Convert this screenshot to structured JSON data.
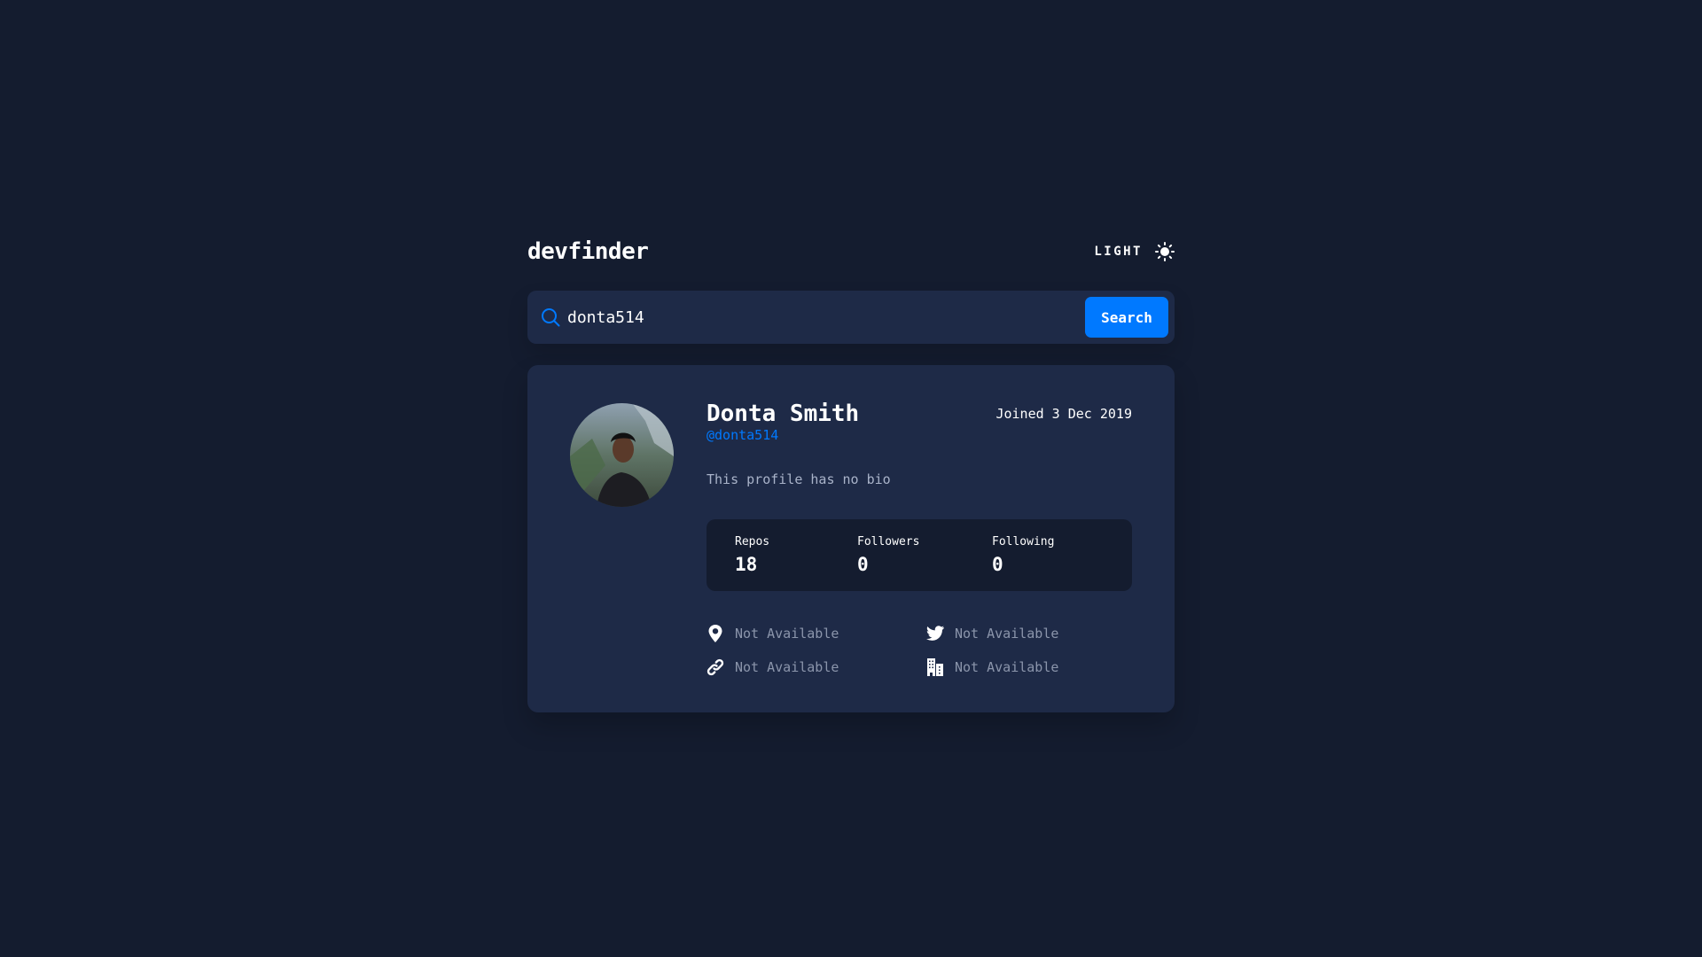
{
  "app": {
    "logo": "devfinder",
    "theme_label": "LIGHT"
  },
  "search": {
    "value": "donta514",
    "button_label": "Search"
  },
  "profile": {
    "name": "Donta Smith",
    "login": "@donta514",
    "joined": "Joined 3 Dec 2019",
    "bio": "This profile has no bio"
  },
  "stats": [
    {
      "label": "Repos",
      "value": "18"
    },
    {
      "label": "Followers",
      "value": "0"
    },
    {
      "label": "Following",
      "value": "0"
    }
  ],
  "links": {
    "location": "Not Available",
    "twitter": "Not Available",
    "blog": "Not Available",
    "company": "Not Available"
  },
  "icons": {
    "theme": "sun-icon",
    "search": "search-icon",
    "location": "location-pin-icon",
    "twitter": "twitter-icon",
    "blog": "link-icon",
    "company": "company-building-icon"
  },
  "colors": {
    "background": "#141c2f",
    "card": "#1e2a47",
    "accent": "#0079ff",
    "muted_text": "#8b95ab"
  }
}
